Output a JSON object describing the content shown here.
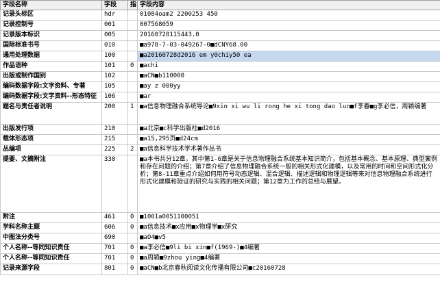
{
  "columns": [
    "字段名称",
    "字段",
    "指",
    "字段内容"
  ],
  "rows": [
    {
      "name": "记录头标区",
      "tag": "hdr",
      "ind": "",
      "content": "01084oam2 2200253   450"
    },
    {
      "name": "记录控制号",
      "tag": "001",
      "ind": "",
      "content": "007568059"
    },
    {
      "name": "记录版本标识",
      "tag": "005",
      "ind": "",
      "content": "20160728115443.0"
    },
    {
      "name": "国际标准书号",
      "tag": "010",
      "ind": "",
      "content": "■a978-7-03-049267-0■dCNY68.00"
    },
    {
      "name": "通用处理数据",
      "tag": "100",
      "ind": "",
      "content": "■a20160728d2016    em y0chiy50      ea"
    },
    {
      "name": "作品语种",
      "tag": "101",
      "ind": "0",
      "content": "■achi"
    },
    {
      "name": "出版或制作国别",
      "tag": "102",
      "ind": "",
      "content": "■aCN■b110000"
    },
    {
      "name": "编码数据字段:文字资料、专著",
      "tag": "105",
      "ind": "",
      "content": "■ay   z   000yy"
    },
    {
      "name": "编码数据字段:文字资料--形态特征",
      "tag": "106",
      "ind": "",
      "content": "■ar"
    },
    {
      "name": "题名与责任者说明",
      "tag": "200",
      "ind": "1",
      "content": "■a信息物理融合系统导论■9xin xi wu li rong he xi tong dao lun■f李春■g李必信，周颖编著"
    },
    {
      "name": "出版发行项",
      "tag": "210",
      "ind": "",
      "content": "■a北京■c科学出版社■d2016"
    },
    {
      "name": "载体形态项",
      "tag": "215",
      "ind": "",
      "content": "■a15,295页■d24cm"
    },
    {
      "name": "丛编项",
      "tag": "225",
      "ind": "2",
      "content": "■a信息科学技术学术著作丛书"
    },
    {
      "name": "提要、文摘附注",
      "tag": "330",
      "ind": "",
      "content": "■a本书共分12章，其中第1-6章是关于信息物理融合系统基本知识简介，包括基本概念、基本原理、典型案例和存在问题的介绍；第7章介绍了信息物理融合系统一般的相关形式化建模，以及常用的时间和空间形式化分析；第8-11章重点介绍如何用符号动态逻辑、混合逻辑、描述逻辑和物理逻辑等来对信息物理融合系统进行形式化建模和验证的研究与实践的相关问题；第12章为工作的总结与展望。"
    },
    {
      "name": "附注",
      "tag": "461",
      "ind": "0",
      "content": "■1001a0051100051"
    },
    {
      "name": "学科名称主题",
      "tag": "606",
      "ind": "0",
      "content": "■a信息技术■x应用■x物理学■x研究"
    },
    {
      "name": "中图法分类号",
      "tag": "690",
      "ind": "",
      "content": "■aO4■v5"
    },
    {
      "name": "个人名称--等同知识责任",
      "tag": "701",
      "ind": "0",
      "content": "■a李必信■9li bi xin■f(1969-)■4编著"
    },
    {
      "name": "个人名称--等同知识责任",
      "tag": "701",
      "ind": "0",
      "content": "■a周颖■9zhou ying■4编著"
    },
    {
      "name": "记录来源字段",
      "tag": "801",
      "ind": "0",
      "content": "■aCN■b北京春秋阅读文化传播有限公司■c20160728"
    }
  ]
}
